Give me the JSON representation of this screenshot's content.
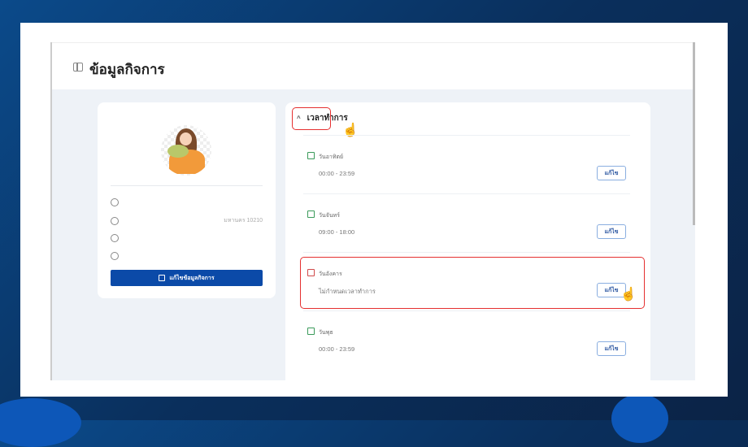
{
  "page": {
    "title": "ข้อมูลกิจการ"
  },
  "business_card": {
    "info": [
      {
        "icon": "store-icon",
        "value": ""
      },
      {
        "icon": "location-icon",
        "value": "มหานคร 10210"
      },
      {
        "icon": "phone-icon",
        "value": ""
      },
      {
        "icon": "clock-icon",
        "value": ""
      }
    ],
    "edit_label": "แก้ไขข้อมูลกิจการ"
  },
  "hours": {
    "section_title": "เวลาทำการ",
    "edit_label": "แก้ไข",
    "days": [
      {
        "name": "วันอาทิตย์",
        "time": "00:00 - 23:59",
        "open": true
      },
      {
        "name": "วันจันทร์",
        "time": "09:00 - 18:00",
        "open": true
      },
      {
        "name": "วันอังคาร",
        "time": "ไม่กำหนดเวลาทำการ",
        "open": false
      },
      {
        "name": "วันพุธ",
        "time": "00:00 - 23:59",
        "open": true
      }
    ]
  }
}
